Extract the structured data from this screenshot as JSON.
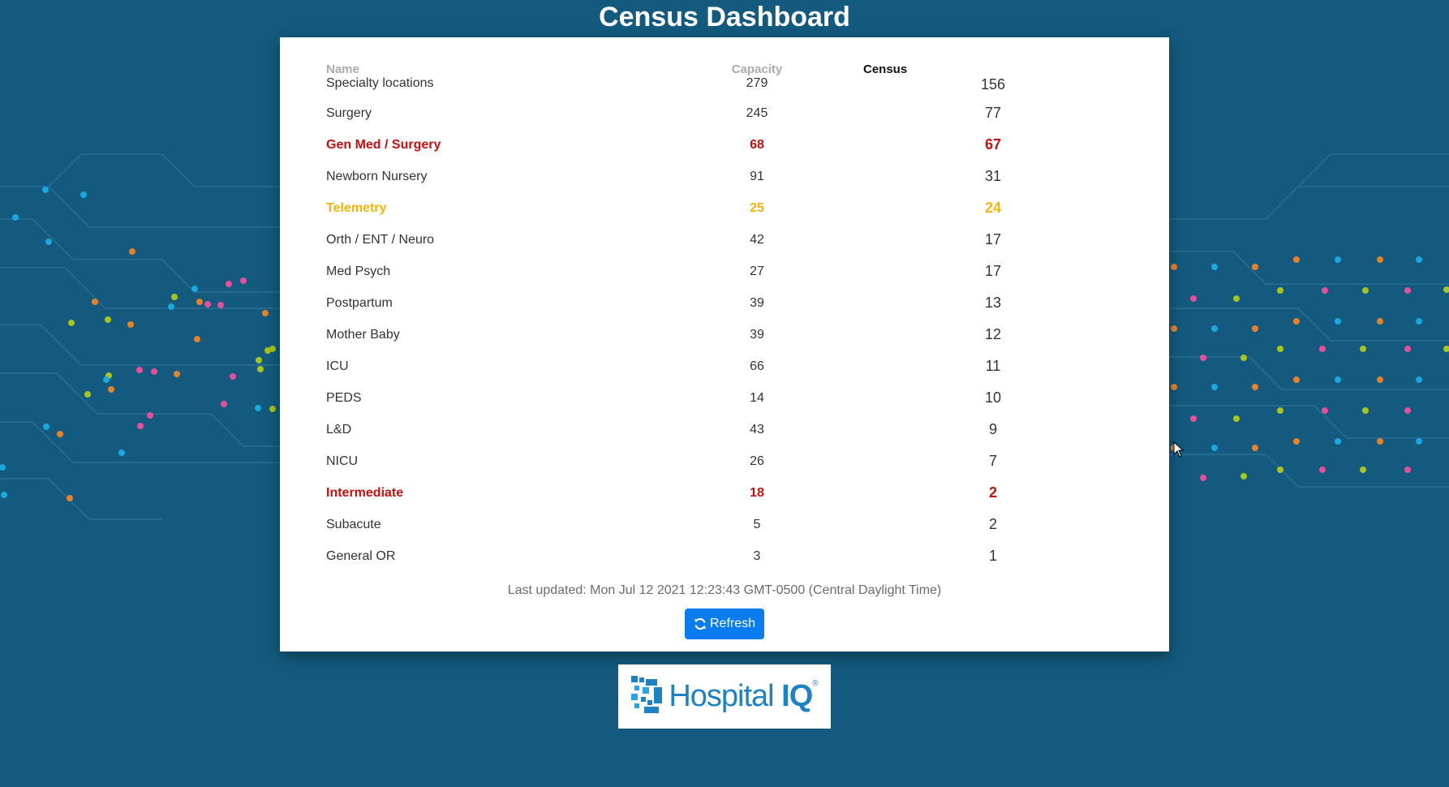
{
  "page": {
    "title": "Census Dashboard"
  },
  "table": {
    "headers": {
      "name": "Name",
      "capacity": "Capacity",
      "census": "Census"
    },
    "rows": [
      {
        "name": "Specialty locations",
        "capacity": "279",
        "census": "156",
        "status": "normal"
      },
      {
        "name": "Surgery",
        "capacity": "245",
        "census": "77",
        "status": "normal"
      },
      {
        "name": "Gen Med / Surgery",
        "capacity": "68",
        "census": "67",
        "status": "critical"
      },
      {
        "name": "Newborn Nursery",
        "capacity": "91",
        "census": "31",
        "status": "normal"
      },
      {
        "name": "Telemetry",
        "capacity": "25",
        "census": "24",
        "status": "warning"
      },
      {
        "name": "Orth / ENT / Neuro",
        "capacity": "42",
        "census": "17",
        "status": "normal"
      },
      {
        "name": "Med Psych",
        "capacity": "27",
        "census": "17",
        "status": "normal"
      },
      {
        "name": "Postpartum",
        "capacity": "39",
        "census": "13",
        "status": "normal"
      },
      {
        "name": "Mother Baby",
        "capacity": "39",
        "census": "12",
        "status": "normal"
      },
      {
        "name": "ICU",
        "capacity": "66",
        "census": "11",
        "status": "normal"
      },
      {
        "name": "PEDS",
        "capacity": "14",
        "census": "10",
        "status": "normal"
      },
      {
        "name": "L&D",
        "capacity": "43",
        "census": "9",
        "status": "normal"
      },
      {
        "name": "NICU",
        "capacity": "26",
        "census": "7",
        "status": "normal"
      },
      {
        "name": "Intermediate",
        "capacity": "18",
        "census": "2",
        "status": "critical"
      },
      {
        "name": "Subacute",
        "capacity": "5",
        "census": "2",
        "status": "normal"
      },
      {
        "name": "General OR",
        "capacity": "3",
        "census": "1",
        "status": "normal"
      }
    ]
  },
  "footer": {
    "last_updated": "Last updated: Mon Jul 12 2021 12:23:43 GMT-0500 (Central Daylight Time)",
    "refresh_label": "Refresh"
  },
  "logo": {
    "text_main": "Hospital",
    "text_accent": "IQ",
    "mark": "®"
  },
  "colors": {
    "background": "#135a7e",
    "critical": "#c80f0f",
    "warning": "#f5b40a",
    "button": "#0b7bf0",
    "brand": "#1d82c4"
  },
  "icons": {
    "refresh": "refresh-icon",
    "logo_mark": "hospital-iq-logo-mark"
  }
}
